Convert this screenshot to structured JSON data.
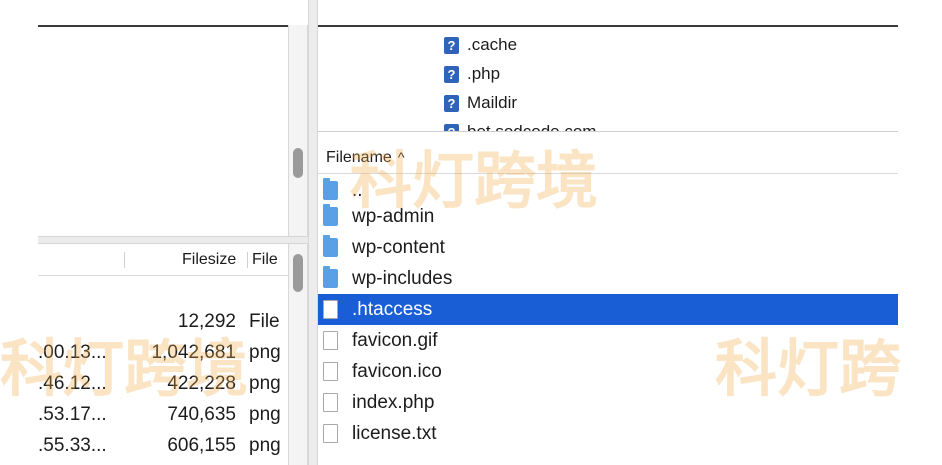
{
  "left_bottom": {
    "headers": {
      "filesize": "Filesize",
      "filetype": "File"
    },
    "rows": [
      {
        "date": "",
        "size": "12,292",
        "type": "File"
      },
      {
        "date": ".00.13...",
        "size": "1,042,681",
        "type": "png"
      },
      {
        "date": ".46.12...",
        "size": "422,228",
        "type": "png"
      },
      {
        "date": ".53.17...",
        "size": "740,635",
        "type": "png"
      },
      {
        "date": ".55.33...",
        "size": "606,155",
        "type": "png"
      }
    ]
  },
  "remote_tree": {
    "items": [
      {
        "icon": "unknown-question-icon",
        "label": ".cache"
      },
      {
        "icon": "unknown-question-icon",
        "label": ".php"
      },
      {
        "icon": "unknown-question-icon",
        "label": "Maildir"
      },
      {
        "icon": "unknown-question-icon",
        "label": "bet.sodcode.com"
      }
    ]
  },
  "remote_list": {
    "header": {
      "filename": "Filename",
      "sort_indicator": "^"
    },
    "rows": [
      {
        "kind": "folder",
        "name": "..",
        "selected": false
      },
      {
        "kind": "folder",
        "name": "wp-admin",
        "selected": false
      },
      {
        "kind": "folder",
        "name": "wp-content",
        "selected": false
      },
      {
        "kind": "folder",
        "name": "wp-includes",
        "selected": false
      },
      {
        "kind": "file",
        "name": ".htaccess",
        "selected": true
      },
      {
        "kind": "file",
        "name": "favicon.gif",
        "selected": false
      },
      {
        "kind": "file",
        "name": "favicon.ico",
        "selected": false
      },
      {
        "kind": "file",
        "name": "index.php",
        "selected": false
      },
      {
        "kind": "file",
        "name": "license.txt",
        "selected": false
      }
    ],
    "selection_color": "#1a5ed6"
  },
  "watermark": {
    "text_right_top": "科灯跨境",
    "text_left": "科灯跨境",
    "text_right_bottom": "科灯跨",
    "color": "#f0aa46"
  }
}
